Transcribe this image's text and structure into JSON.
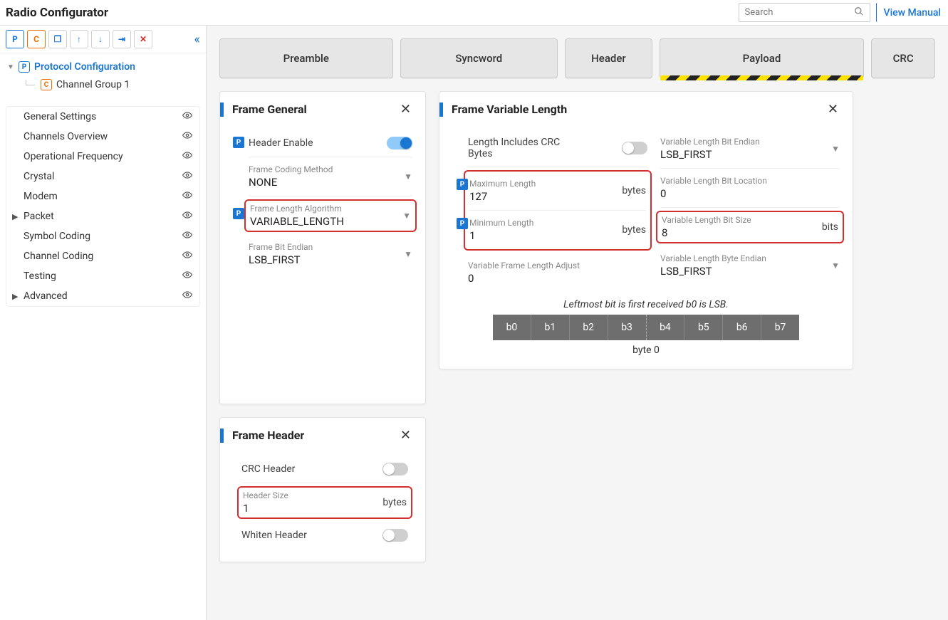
{
  "topbar": {
    "title": "Radio Configurator",
    "search_placeholder": "Search",
    "view_manual": "View Manual"
  },
  "toolbar_icons": {
    "p": "P",
    "c": "C",
    "copy": "❐",
    "up": "↑",
    "down": "↓",
    "import": "⇥",
    "delete": "✕"
  },
  "tree": {
    "root_label": "Protocol Configuration",
    "child_label": "Channel Group 1"
  },
  "nav": [
    {
      "label": "General Settings",
      "expandable": false
    },
    {
      "label": "Channels Overview",
      "expandable": false
    },
    {
      "label": "Operational Frequency",
      "expandable": false
    },
    {
      "label": "Crystal",
      "expandable": false
    },
    {
      "label": "Modem",
      "expandable": false
    },
    {
      "label": "Packet",
      "expandable": true
    },
    {
      "label": "Symbol Coding",
      "expandable": false
    },
    {
      "label": "Channel Coding",
      "expandable": false
    },
    {
      "label": "Testing",
      "expandable": false
    },
    {
      "label": "Advanced",
      "expandable": true
    }
  ],
  "packet_tabs": [
    {
      "label": "Preamble",
      "cls": "preamble"
    },
    {
      "label": "Syncword",
      "cls": "syncword"
    },
    {
      "label": "Header",
      "cls": "header"
    },
    {
      "label": "Payload",
      "cls": "payload",
      "selected": true
    },
    {
      "label": "CRC",
      "cls": "crc"
    }
  ],
  "cards": {
    "frame_general": {
      "title": "Frame General",
      "header_enable_label": "Header Enable",
      "header_enable_on": true,
      "coding_label": "Frame Coding Method",
      "coding_value": "NONE",
      "algo_label": "Frame Length Algorithm",
      "algo_value": "VARIABLE_LENGTH",
      "bitendian_label": "Frame Bit Endian",
      "bitendian_value": "LSB_FIRST"
    },
    "frame_varlen": {
      "title": "Frame Variable Length",
      "inc_crc_label": "Length Includes CRC Bytes",
      "max_label": "Maximum Length",
      "max_value": "127",
      "max_unit": "bytes",
      "min_label": "Minimum Length",
      "min_value": "1",
      "min_unit": "bytes",
      "adj_label": "Variable Frame Length Adjust",
      "adj_value": "0",
      "bend_label": "Variable Length Bit Endian",
      "bend_value": "LSB_FIRST",
      "bloc_label": "Variable Length Bit Location",
      "bloc_value": "0",
      "bsize_label": "Variable Length Bit Size",
      "bsize_value": "8",
      "bsize_unit": "bits",
      "byend_label": "Variable Length Byte Endian",
      "byend_value": "LSB_FIRST",
      "note": "Leftmost bit is first received b0 is LSB.",
      "bits": [
        "b0",
        "b1",
        "b2",
        "b3",
        "b4",
        "b5",
        "b6",
        "b7"
      ],
      "byte_label": "byte 0"
    },
    "frame_header": {
      "title": "Frame Header",
      "crc_label": "CRC Header",
      "size_label": "Header Size",
      "size_value": "1",
      "size_unit": "bytes",
      "whiten_label": "Whiten Header"
    }
  }
}
